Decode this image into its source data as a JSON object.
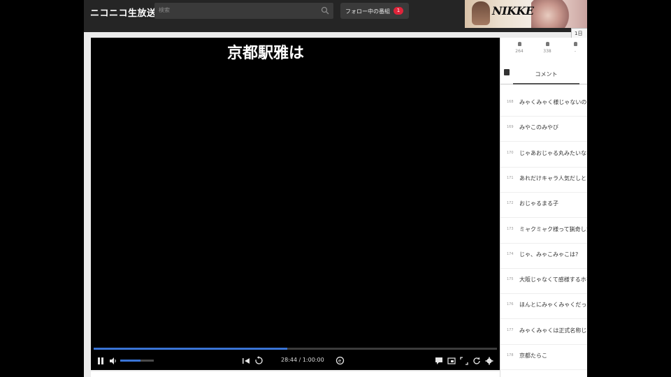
{
  "header": {
    "logo": "ニコニコ生放送",
    "search_placeholder": "検索",
    "follow_label": "フォロー中の番組",
    "follow_badge": "1"
  },
  "ad": {
    "logo": "NIKKE",
    "tooltip": "1日"
  },
  "player": {
    "telop": "京都駅雅は",
    "time": "28:44 / 1:00:00",
    "progress": 0.48,
    "volume": 0.6
  },
  "side": {
    "stats": [
      {
        "value": "264"
      },
      {
        "value": "338"
      },
      {
        "value": "-"
      }
    ],
    "tab_label": "コメント",
    "comments": [
      {
        "no": "168",
        "text": "みゃくみゃく様じゃないの?"
      },
      {
        "no": "169",
        "text": "みやこのみやび"
      },
      {
        "no": "170",
        "text": "じゃあおじゃる丸みたいな名前"
      },
      {
        "no": "171",
        "text": "あれだけキャラ人気だしといて"
      },
      {
        "no": "172",
        "text": "おじゃるまる子"
      },
      {
        "no": "173",
        "text": "ミャクミャク様って猟奇したん"
      },
      {
        "no": "174",
        "text": "じゃ、みゃこみゃこは?"
      },
      {
        "no": "175",
        "text": "大阪じゃなくて感様するホをイ"
      },
      {
        "no": "176",
        "text": "ほんとにみゃくみゃくだった"
      },
      {
        "no": "177",
        "text": "みゃくみゃくは正式名称じゃな"
      },
      {
        "no": "178",
        "text": "京都たらこ"
      }
    ]
  }
}
